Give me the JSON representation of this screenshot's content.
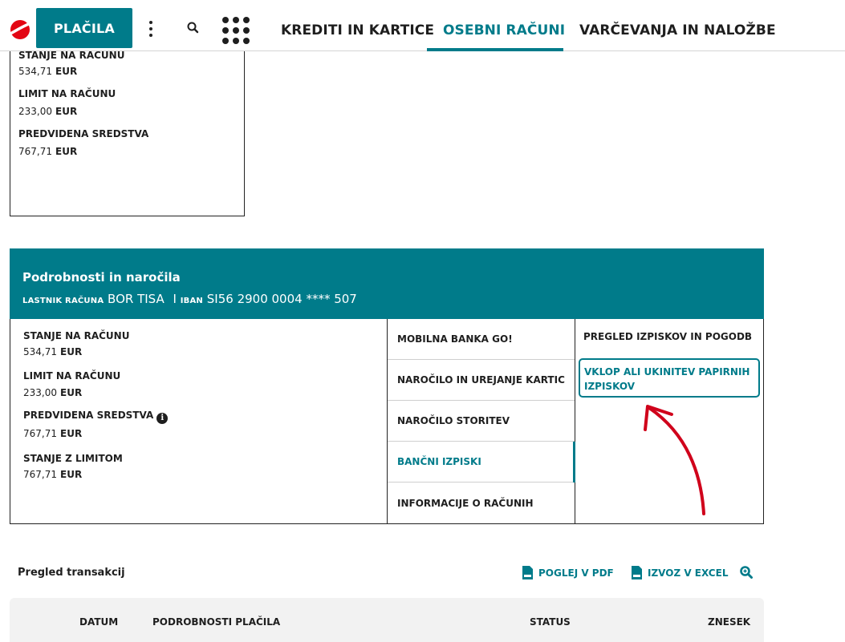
{
  "header": {
    "pay_button": "PLAČILA",
    "tabs": [
      {
        "label": "KREDITI IN KARTICE",
        "active": false
      },
      {
        "label": "OSEBNI RAČUNI",
        "active": true
      },
      {
        "label": "VARČEVANJA IN NALOŽBE",
        "active": false
      }
    ],
    "brand_color": "#e30613",
    "accent_color": "#007b8a"
  },
  "top_card": {
    "balance_label": "STANJE NA RAČUNU",
    "balance_value": "534,71",
    "limit_label": "LIMIT NA RAČUNU",
    "limit_value": "233,00",
    "available_label": "PREDVIDENA SREDSTVA",
    "available_value": "767,71",
    "currency": "EUR"
  },
  "details": {
    "title": "Podrobnosti in naročila",
    "owner_label": "LASTNIK RAČUNA",
    "owner_name": "BOR TISA",
    "separator": "I",
    "iban_label": "IBAN",
    "iban_value": "SI56 2900 0004 **** 507",
    "balance_label": "STANJE NA RAČUNU",
    "balance_value": "534,71",
    "limit_label": "LIMIT NA RAČUNU",
    "limit_value": "233,00",
    "available_label": "PREDVIDENA SREDSTVA",
    "available_value": "767,71",
    "with_limit_label": "STANJE Z LIMITOM",
    "with_limit_value": "767,71",
    "currency": "EUR",
    "menu": [
      {
        "label": "MOBILNA BANKA GO!",
        "active": false
      },
      {
        "label": "NAROČILO IN UREJANJE KARTIC",
        "active": false
      },
      {
        "label": "NAROČILO STORITEV",
        "active": false
      },
      {
        "label": "BANČNI IZPISKI",
        "active": true
      },
      {
        "label": "INFORMACIJE O RAČUNIH",
        "active": false
      }
    ],
    "right_title": "PREGLED IZPISKOV IN POGODB",
    "right_button": "VKLOP ALI UKINITEV PAPIRNIH IZPISKOV"
  },
  "transactions": {
    "title": "Pregled transakcij",
    "pdf_label": "POGLEJ V PDF",
    "excel_label": "IZVOZ V EXCEL",
    "columns": [
      "DATUM",
      "PODROBNOSTI PLAČILA",
      "STATUS",
      "ZNESEK"
    ]
  },
  "icons": {
    "logo": "unicredit-logo-icon",
    "more": "kebab-menu-icon",
    "search": "search-icon",
    "apps": "apps-grid-icon",
    "info": "info-icon",
    "pdf": "pdf-file-icon",
    "excel": "excel-file-icon",
    "annotation": "red-arrow-icon"
  }
}
